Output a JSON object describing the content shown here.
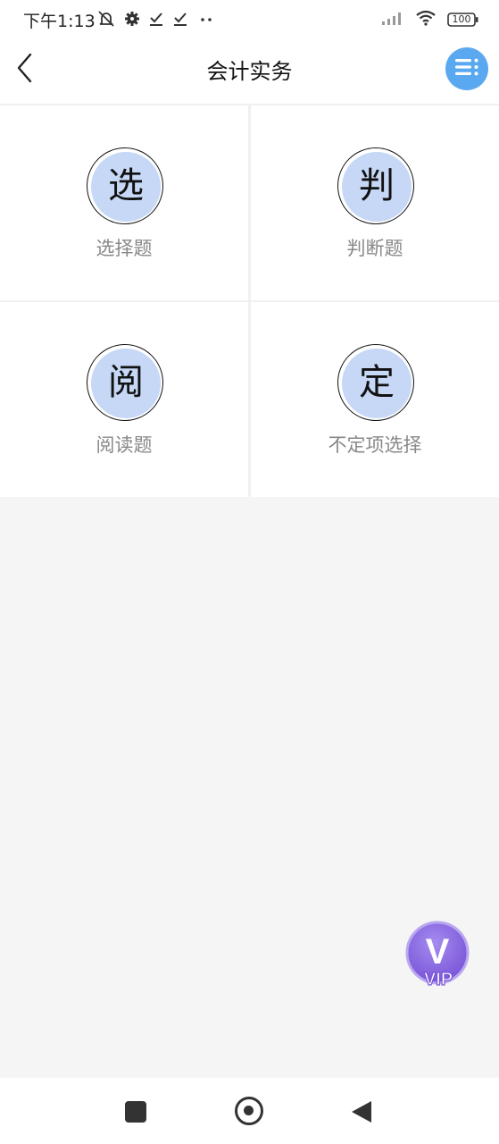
{
  "status_bar": {
    "time": "下午1:13",
    "battery": "100",
    "icons": [
      "mute-bell-icon",
      "gear-icon",
      "download-check-icon",
      "download-check-icon",
      "more-dots-icon",
      "signal-icon",
      "wifi-icon",
      "battery-icon"
    ]
  },
  "header": {
    "title": "会计实务",
    "back_icon": "chevron-left-icon",
    "menu_icon": "list-menu-icon",
    "menu_color": "#5aa9f0"
  },
  "categories": [
    {
      "char": "选",
      "label": "选择题"
    },
    {
      "char": "判",
      "label": "判断题"
    },
    {
      "char": "阅",
      "label": "阅读题"
    },
    {
      "char": "定",
      "label": "不定项选择"
    }
  ],
  "vip": {
    "letter": "V",
    "label": "VIP",
    "color": "#8e6fe3"
  },
  "nav": {
    "icons": [
      "recent-apps-icon",
      "home-icon",
      "back-icon"
    ]
  },
  "colors": {
    "circle_fill": "#c6d8f6",
    "label_gray": "#888888"
  }
}
